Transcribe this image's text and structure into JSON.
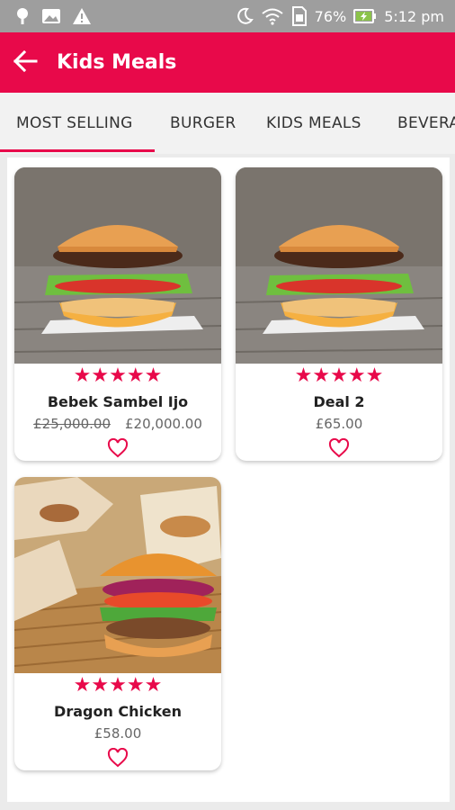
{
  "status_bar": {
    "battery": "76%",
    "time": "5:12 pm",
    "icons": [
      "maps-pin-icon",
      "image-icon",
      "warning-icon",
      "moon-icon",
      "wifi-icon",
      "sim-icon",
      "battery-charging-icon"
    ]
  },
  "app_bar": {
    "title": "Kids Meals",
    "back_icon": "arrow-left-icon"
  },
  "tabs": [
    {
      "label": "MOST SELLING",
      "selected": true
    },
    {
      "label": "BURGER",
      "selected": false
    },
    {
      "label": "KIDS MEALS",
      "selected": false
    },
    {
      "label": "BEVERA",
      "selected": false
    }
  ],
  "products": [
    {
      "name": "Bebek Sambel Ijo",
      "old_price": "£25,000.00",
      "price": "£20,000.00",
      "rating": 5
    },
    {
      "name": "Deal 2",
      "old_price": "",
      "price": "£65.00",
      "rating": 5
    },
    {
      "name": "Dragon Chicken",
      "old_price": "",
      "price": "£58.00",
      "rating": 5
    }
  ],
  "colors": {
    "accent": "#e8094a",
    "status_bar": "#9e9e9e"
  }
}
